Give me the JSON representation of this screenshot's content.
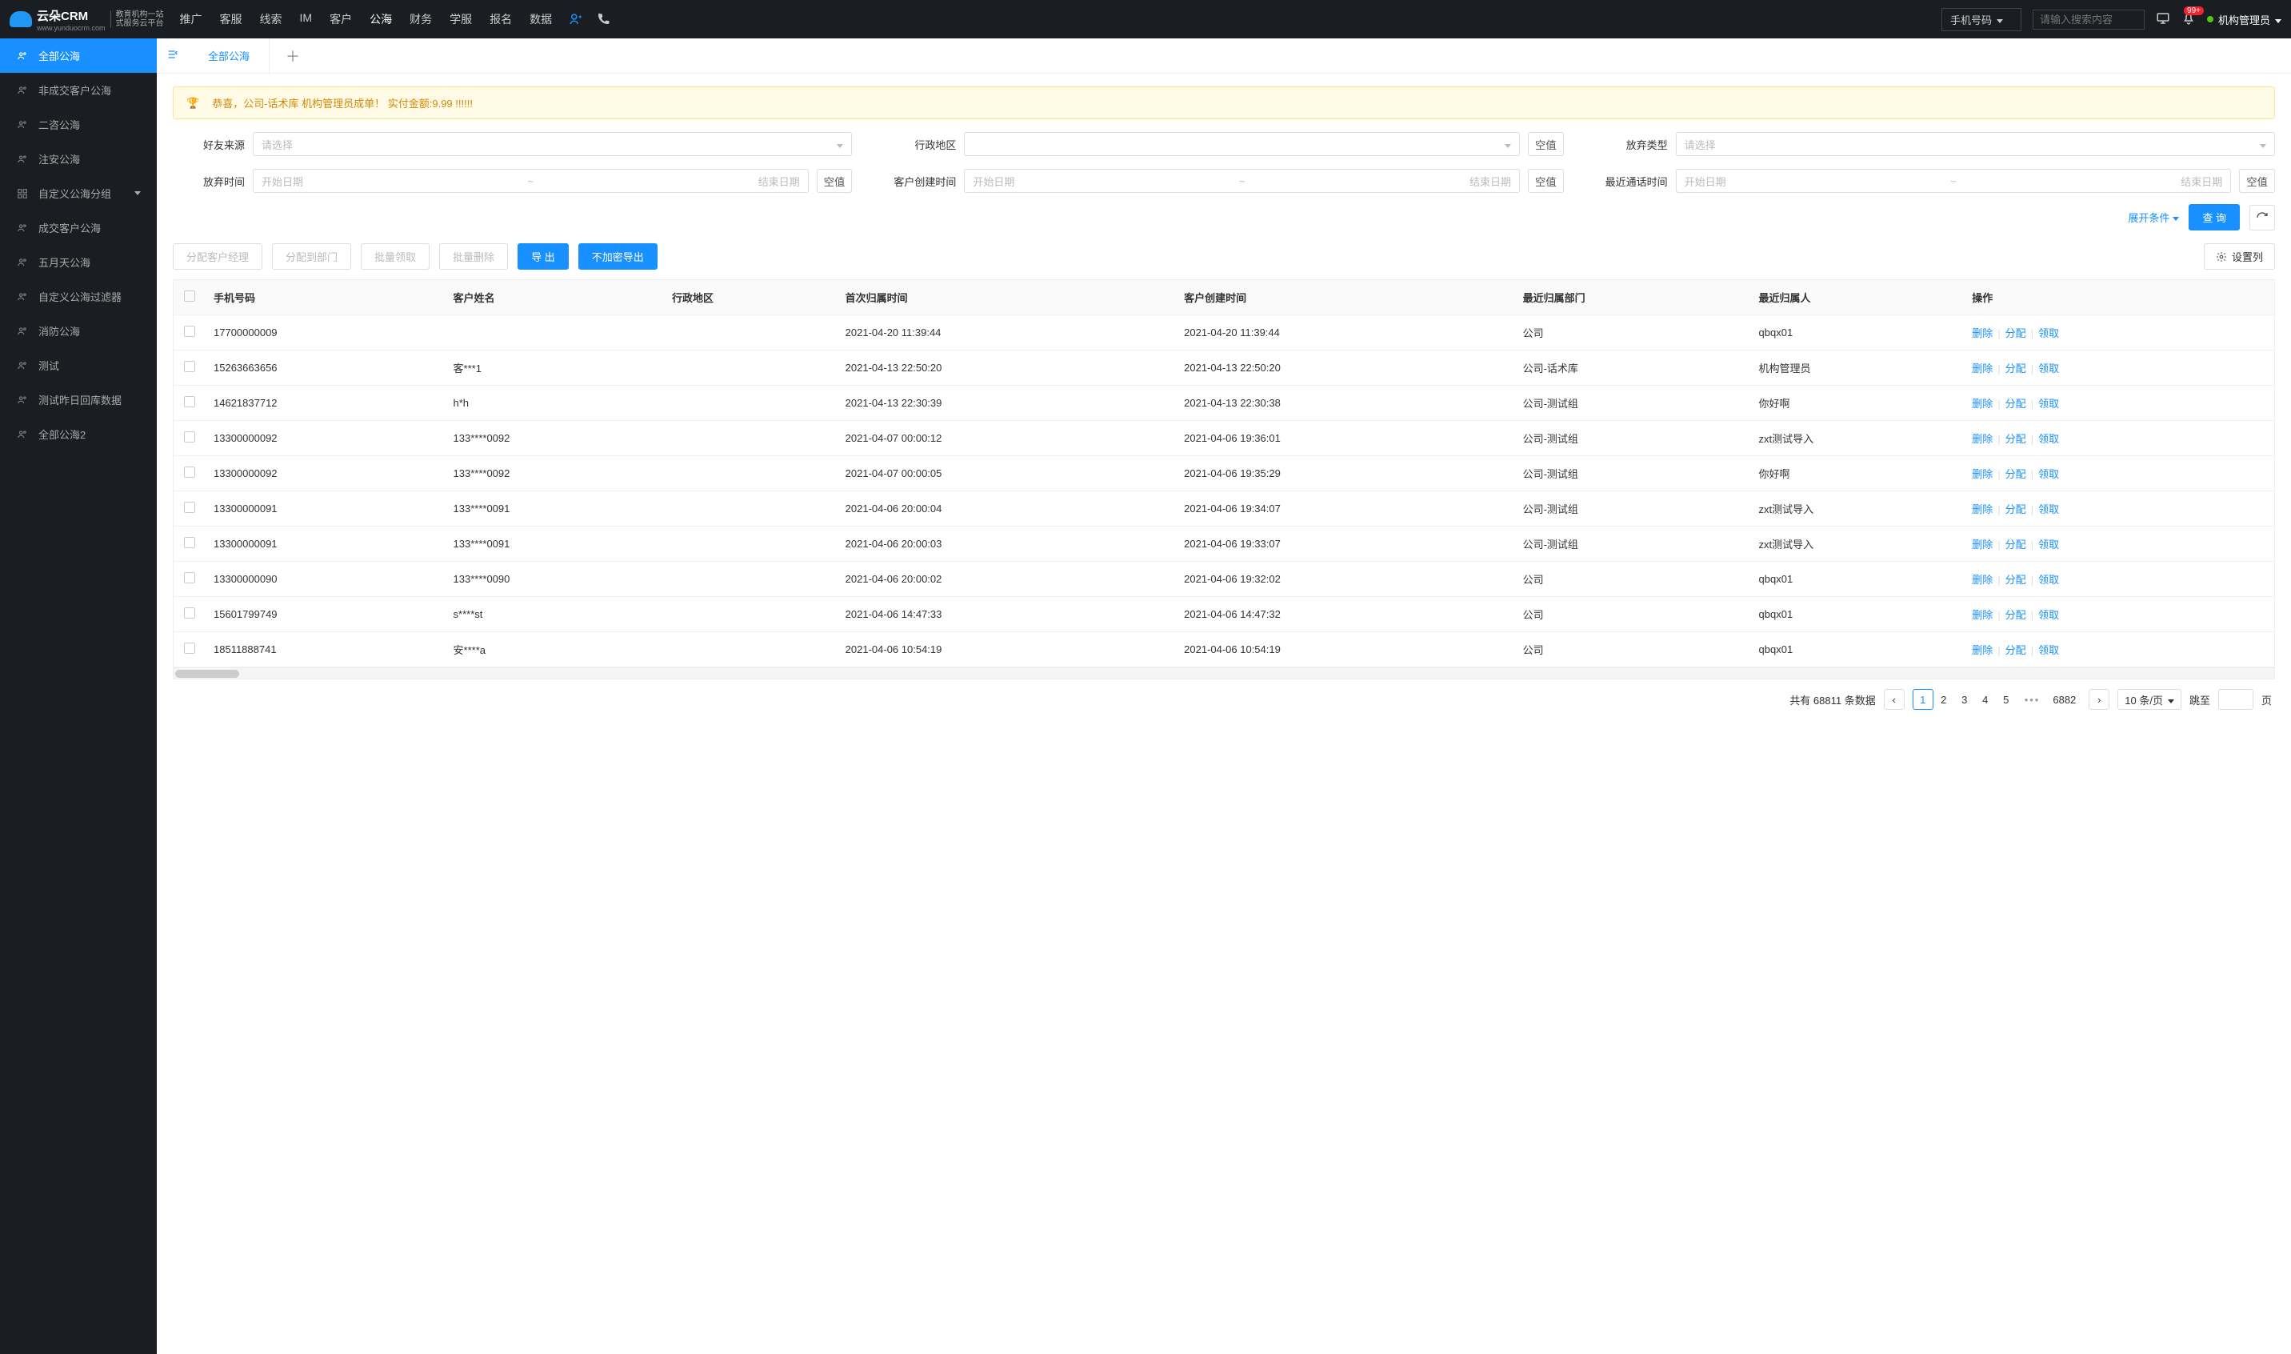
{
  "header": {
    "logo_main": "云朵CRM",
    "logo_sub1": "教育机构一站",
    "logo_sub2": "式服务云平台",
    "logo_url": "www.yunduocrm.com",
    "nav": [
      "推广",
      "客服",
      "线索",
      "IM",
      "客户",
      "公海",
      "财务",
      "学服",
      "报名",
      "数据"
    ],
    "nav_active_index": 5,
    "search_type": "手机号码",
    "search_placeholder": "请输入搜索内容",
    "badge_count": "99+",
    "user_name": "机构管理员"
  },
  "sidebar": {
    "items": [
      {
        "label": "全部公海",
        "active": true
      },
      {
        "label": "非成交客户公海"
      },
      {
        "label": "二咨公海"
      },
      {
        "label": "注安公海"
      },
      {
        "label": "自定义公海分组",
        "expandable": true
      },
      {
        "label": "成交客户公海"
      },
      {
        "label": "五月天公海"
      },
      {
        "label": "自定义公海过滤器"
      },
      {
        "label": "消防公海"
      },
      {
        "label": "测试"
      },
      {
        "label": "测试昨日回库数据"
      },
      {
        "label": "全部公海2"
      }
    ]
  },
  "tabs": {
    "active": "全部公海"
  },
  "notice": "恭喜，公司-话术库  机构管理员成单！  实付金额:9.99 !!!!!!",
  "filters": {
    "friend_source_label": "好友来源",
    "region_label": "行政地区",
    "abandon_type_label": "放弃类型",
    "abandon_time_label": "放弃时间",
    "customer_create_label": "客户创建时间",
    "last_call_label": "最近通话时间",
    "select_placeholder": "请选择",
    "date_start": "开始日期",
    "date_end": "结束日期",
    "empty_btn": "空值",
    "expand": "展开条件",
    "query": "查 询"
  },
  "actions": {
    "assign_manager": "分配客户经理",
    "assign_dept": "分配到部门",
    "batch_claim": "批量领取",
    "batch_delete": "批量删除",
    "export": "导 出",
    "export_plain": "不加密导出",
    "set_columns": "设置列"
  },
  "table": {
    "headers": [
      "手机号码",
      "客户姓名",
      "行政地区",
      "首次归属时间",
      "客户创建时间",
      "最近归属部门",
      "最近归属人",
      "操作"
    ],
    "op_delete": "删除",
    "op_assign": "分配",
    "op_claim": "领取",
    "rows": [
      {
        "phone": "17700000009",
        "name": "",
        "region": "",
        "first_time": "2021-04-20 11:39:44",
        "create_time": "2021-04-20 11:39:44",
        "dept": "公司",
        "owner": "qbqx01"
      },
      {
        "phone": "15263663656",
        "name": "客***1",
        "region": "",
        "first_time": "2021-04-13 22:50:20",
        "create_time": "2021-04-13 22:50:20",
        "dept": "公司-话术库",
        "owner": "机构管理员"
      },
      {
        "phone": "14621837712",
        "name": "h*h",
        "region": "",
        "first_time": "2021-04-13 22:30:39",
        "create_time": "2021-04-13 22:30:38",
        "dept": "公司-测试组",
        "owner": "你好啊"
      },
      {
        "phone": "13300000092",
        "name": "133****0092",
        "region": "",
        "first_time": "2021-04-07 00:00:12",
        "create_time": "2021-04-06 19:36:01",
        "dept": "公司-测试组",
        "owner": "zxt测试导入"
      },
      {
        "phone": "13300000092",
        "name": "133****0092",
        "region": "",
        "first_time": "2021-04-07 00:00:05",
        "create_time": "2021-04-06 19:35:29",
        "dept": "公司-测试组",
        "owner": "你好啊"
      },
      {
        "phone": "13300000091",
        "name": "133****0091",
        "region": "",
        "first_time": "2021-04-06 20:00:04",
        "create_time": "2021-04-06 19:34:07",
        "dept": "公司-测试组",
        "owner": "zxt测试导入"
      },
      {
        "phone": "13300000091",
        "name": "133****0091",
        "region": "",
        "first_time": "2021-04-06 20:00:03",
        "create_time": "2021-04-06 19:33:07",
        "dept": "公司-测试组",
        "owner": "zxt测试导入"
      },
      {
        "phone": "13300000090",
        "name": "133****0090",
        "region": "",
        "first_time": "2021-04-06 20:00:02",
        "create_time": "2021-04-06 19:32:02",
        "dept": "公司",
        "owner": "qbqx01"
      },
      {
        "phone": "15601799749",
        "name": "s****st",
        "region": "",
        "first_time": "2021-04-06 14:47:33",
        "create_time": "2021-04-06 14:47:32",
        "dept": "公司",
        "owner": "qbqx01"
      },
      {
        "phone": "18511888741",
        "name": "安****a",
        "region": "",
        "first_time": "2021-04-06 10:54:19",
        "create_time": "2021-04-06 10:54:19",
        "dept": "公司",
        "owner": "qbqx01"
      }
    ]
  },
  "pagination": {
    "total_prefix": "共有",
    "total": "68811",
    "total_suffix": "条数据",
    "pages": [
      "1",
      "2",
      "3",
      "4",
      "5"
    ],
    "last_page": "6882",
    "per_page": "10 条/页",
    "jump_label": "跳至",
    "page_suffix": "页"
  }
}
